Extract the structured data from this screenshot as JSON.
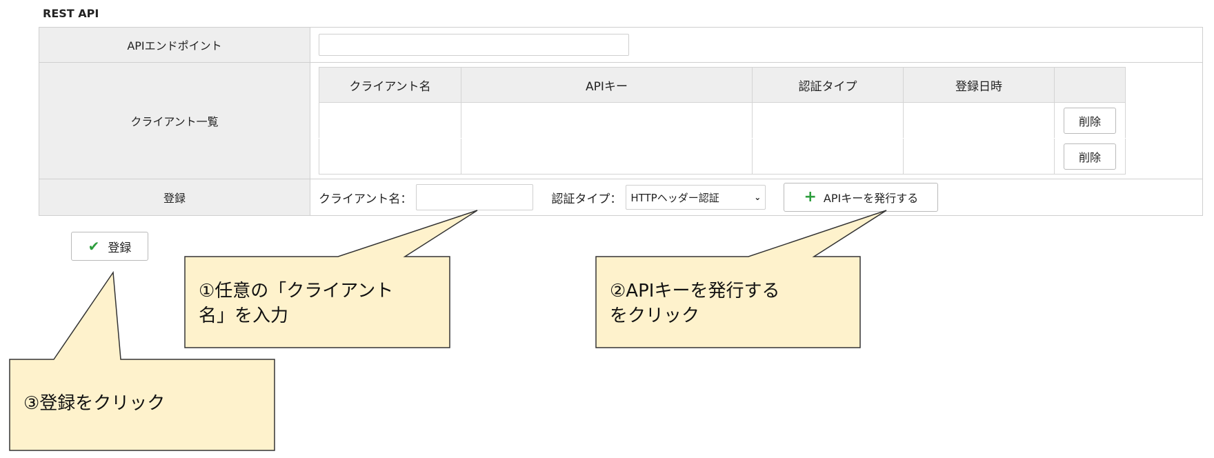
{
  "section": {
    "title": "REST API"
  },
  "endpoint": {
    "label": "APIエンドポイント",
    "value": ""
  },
  "clients": {
    "label": "クライアント一覧",
    "columns": [
      "クライアント名",
      "APIキー",
      "認証タイプ",
      "登録日時"
    ],
    "rows": [
      {
        "name": "",
        "api_key": "",
        "auth_type": "",
        "registered": "",
        "delete_label": "削除"
      },
      {
        "name": "",
        "api_key": "",
        "auth_type": "",
        "registered": "",
        "delete_label": "削除"
      }
    ]
  },
  "register_row": {
    "label": "登録",
    "client_name_label": "クライアント名：",
    "client_name_value": "",
    "auth_type_label": "認証タイプ：",
    "auth_type_selected": "HTTPヘッダー認証",
    "issue_button": "APIキーを発行する"
  },
  "register_button": {
    "label": "登録"
  },
  "callouts": [
    {
      "text": "①任意の「クライアント\n名」を入力"
    },
    {
      "text": "②APIキーを発行する\nをクリック"
    },
    {
      "text": "③登録をクリック"
    }
  ],
  "colors": {
    "callout_fill": "#fef2cc",
    "callout_stroke": "#333333",
    "accent_green": "#2e9e3e",
    "header_bg": "#eeeeee"
  }
}
